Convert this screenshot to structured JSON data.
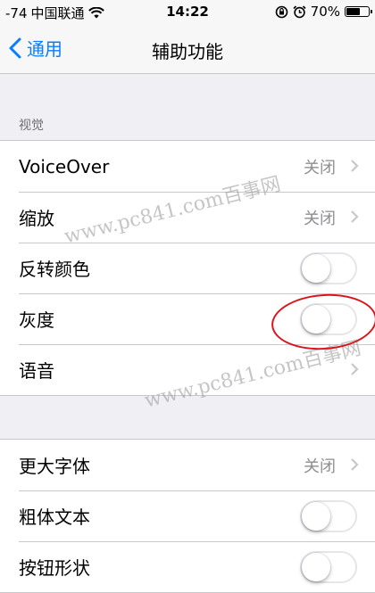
{
  "status_bar": {
    "signal": "-74",
    "carrier": "中国联通",
    "time": "14:22",
    "battery": "70%",
    "battery_level": 0.7
  },
  "nav": {
    "back_label": "通用",
    "title": "辅助功能"
  },
  "sections": {
    "vision_header": "视觉"
  },
  "group1": [
    {
      "label": "VoiceOver",
      "value": "关闭"
    },
    {
      "label": "缩放",
      "value": "关闭"
    },
    {
      "label": "反转颜色",
      "toggle": "off"
    },
    {
      "label": "灰度",
      "toggle": "off"
    },
    {
      "label": "语音"
    }
  ],
  "group2": [
    {
      "label": "更大字体",
      "value": "关闭"
    },
    {
      "label": "粗体文本",
      "toggle": "off"
    },
    {
      "label": "按钮形状",
      "toggle": "off"
    }
  ],
  "watermarks": [
    "www.pc841.com百事网",
    "www.pc841.com百事网"
  ],
  "colors": {
    "accent": "#0a7cff",
    "annotation": "#d9161e",
    "background": "#efeff4"
  }
}
